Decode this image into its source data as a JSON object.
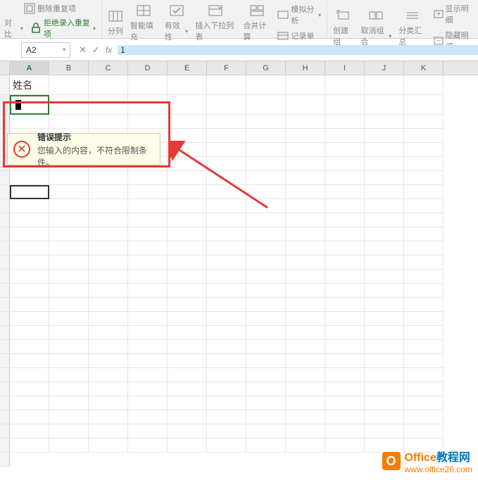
{
  "ribbon": {
    "group1": {
      "btn1": "删除重复项",
      "btn2": "拒绝录入重复项"
    },
    "group2": {
      "btn1": "分列",
      "btn2": "智能填充",
      "btn3": "有效性",
      "btn4": "插入下拉列表",
      "btn5": "合并计算",
      "btn6": "模拟分析",
      "btn7": "记录单"
    },
    "group3": {
      "btn1": "创建组",
      "btn2": "取消组合",
      "btn3": "分类汇总",
      "btn4": "显示明细",
      "btn5": "隐藏明细"
    }
  },
  "formulaBar": {
    "nameBox": "A2",
    "input": "1"
  },
  "columns": [
    "A",
    "B",
    "C",
    "D",
    "E",
    "F",
    "G",
    "H",
    "I",
    "J",
    "K"
  ],
  "cells": {
    "a1": "姓名"
  },
  "errorTip": {
    "title": "错误提示",
    "message": "您输入的内容，不符合限制条件。"
  },
  "contrast": {
    "label": "对比"
  },
  "watermark": {
    "title1": "Office",
    "title2": "教程网",
    "url": "www.office26.com"
  }
}
